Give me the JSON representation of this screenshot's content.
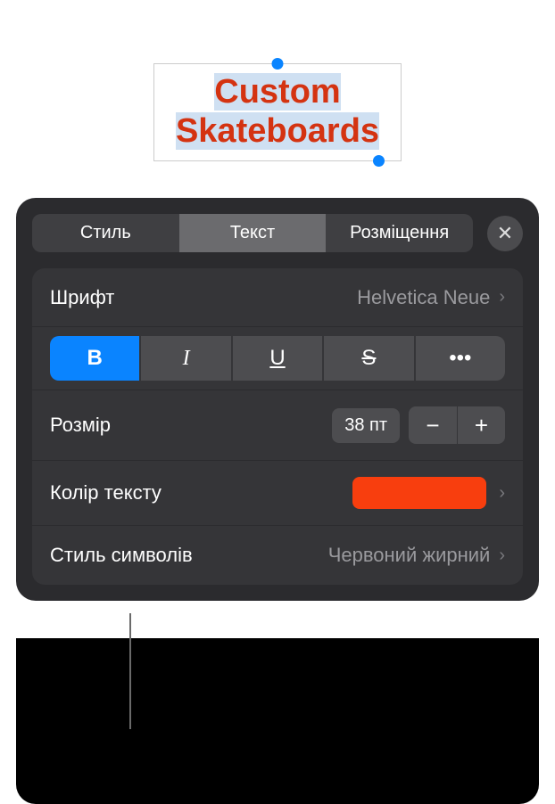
{
  "canvas": {
    "text_line1": "Custom",
    "text_line2": "Skateboards",
    "text_color": "#d43311",
    "selection_bg": "#cfe0f2"
  },
  "panel": {
    "tabs": {
      "style": "Стиль",
      "text": "Текст",
      "arrange": "Розміщення"
    },
    "font": {
      "label": "Шрифт",
      "value": "Helvetica Neue"
    },
    "format": {
      "bold": "B",
      "italic": "I",
      "underline": "U",
      "strike": "S",
      "more": "•••"
    },
    "size": {
      "label": "Розмір",
      "value": "38 пт",
      "minus": "−",
      "plus": "+"
    },
    "textcolor": {
      "label": "Колір тексту",
      "swatch": "#f83e0e"
    },
    "charstyle": {
      "label": "Стиль символів",
      "value": "Червоний жирний"
    }
  }
}
